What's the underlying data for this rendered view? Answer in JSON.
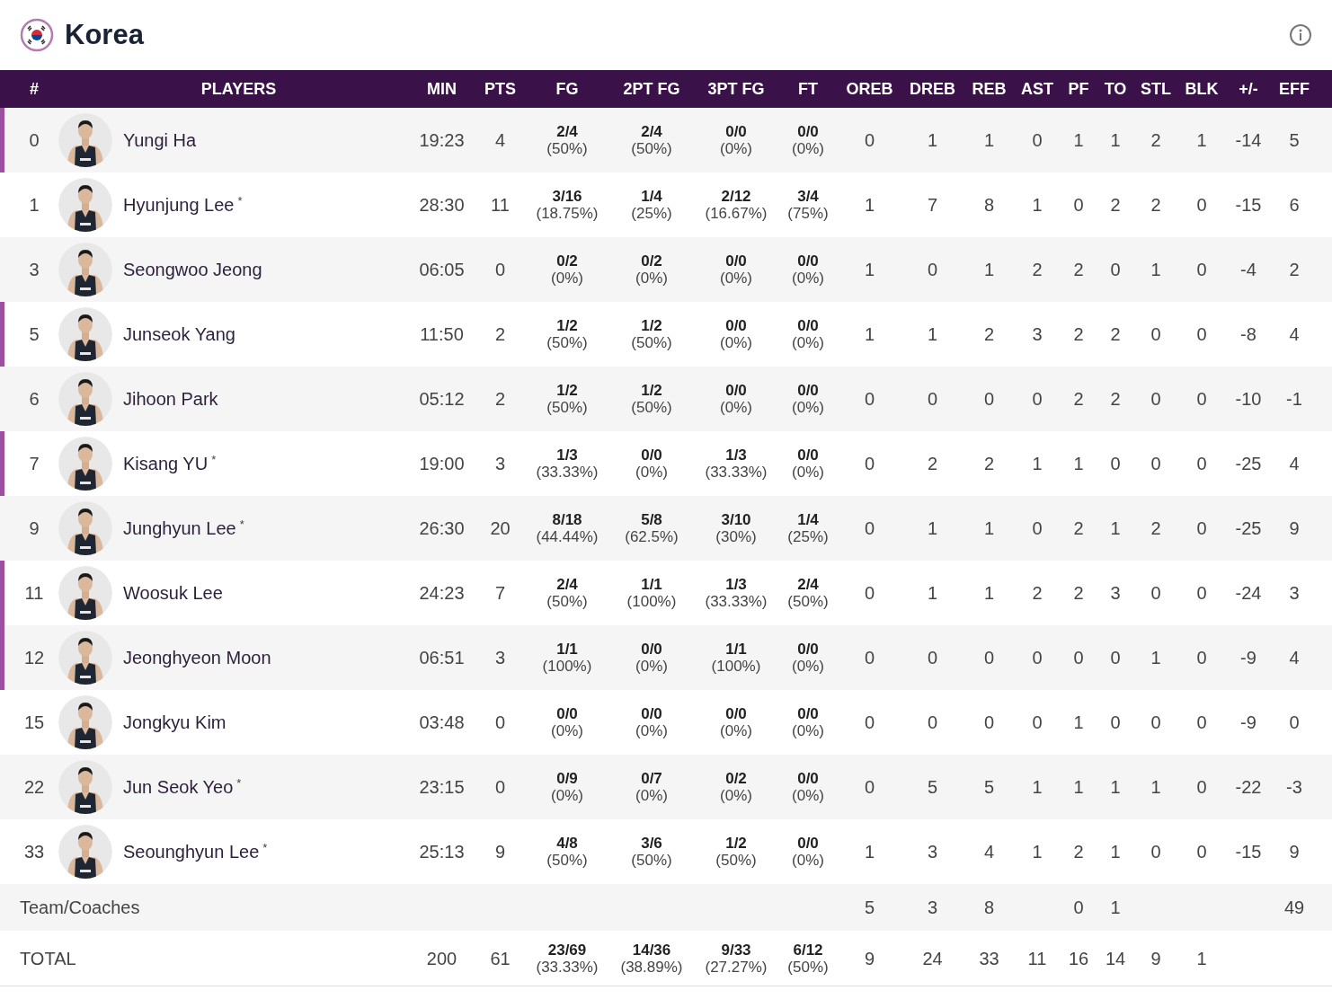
{
  "team": {
    "name": "Korea"
  },
  "columns": [
    "#",
    "PLAYERS",
    "MIN",
    "PTS",
    "FG",
    "2PT FG",
    "3PT FG",
    "FT",
    "OREB",
    "DREB",
    "REB",
    "AST",
    "PF",
    "TO",
    "STL",
    "BLK",
    "+/-",
    "EFF"
  ],
  "players": [
    {
      "number": "0",
      "name": "Yungi Ha",
      "starter": true,
      "min": "19:23",
      "pts": "4",
      "shots": [
        [
          "2/4",
          "(50%)"
        ],
        [
          "2/4",
          "(50%)"
        ],
        [
          "0/0",
          "(0%)"
        ],
        [
          "0/0",
          "(0%)"
        ]
      ],
      "stats": [
        "0",
        "1",
        "1",
        "0",
        "1",
        "1",
        "2",
        "1",
        "-14",
        "5"
      ]
    },
    {
      "number": "1",
      "name": "Hyunjung Lee",
      "mark": "*",
      "starter": false,
      "min": "28:30",
      "pts": "11",
      "shots": [
        [
          "3/16",
          "(18.75%)"
        ],
        [
          "1/4",
          "(25%)"
        ],
        [
          "2/12",
          "(16.67%)"
        ],
        [
          "3/4",
          "(75%)"
        ]
      ],
      "stats": [
        "1",
        "7",
        "8",
        "1",
        "0",
        "2",
        "2",
        "0",
        "-15",
        "6"
      ]
    },
    {
      "number": "3",
      "name": "Seongwoo Jeong",
      "starter": false,
      "min": "06:05",
      "pts": "0",
      "shots": [
        [
          "0/2",
          "(0%)"
        ],
        [
          "0/2",
          "(0%)"
        ],
        [
          "0/0",
          "(0%)"
        ],
        [
          "0/0",
          "(0%)"
        ]
      ],
      "stats": [
        "1",
        "0",
        "1",
        "2",
        "2",
        "0",
        "1",
        "0",
        "-4",
        "2"
      ]
    },
    {
      "number": "5",
      "name": "Junseok Yang",
      "starter": true,
      "min": "11:50",
      "pts": "2",
      "shots": [
        [
          "1/2",
          "(50%)"
        ],
        [
          "1/2",
          "(50%)"
        ],
        [
          "0/0",
          "(0%)"
        ],
        [
          "0/0",
          "(0%)"
        ]
      ],
      "stats": [
        "1",
        "1",
        "2",
        "3",
        "2",
        "2",
        "0",
        "0",
        "-8",
        "4"
      ]
    },
    {
      "number": "6",
      "name": "Jihoon Park",
      "starter": false,
      "min": "05:12",
      "pts": "2",
      "shots": [
        [
          "1/2",
          "(50%)"
        ],
        [
          "1/2",
          "(50%)"
        ],
        [
          "0/0",
          "(0%)"
        ],
        [
          "0/0",
          "(0%)"
        ]
      ],
      "stats": [
        "0",
        "0",
        "0",
        "0",
        "2",
        "2",
        "0",
        "0",
        "-10",
        "-1"
      ]
    },
    {
      "number": "7",
      "name": "Kisang YU",
      "mark": "*",
      "starter": true,
      "min": "19:00",
      "pts": "3",
      "shots": [
        [
          "1/3",
          "(33.33%)"
        ],
        [
          "0/0",
          "(0%)"
        ],
        [
          "1/3",
          "(33.33%)"
        ],
        [
          "0/0",
          "(0%)"
        ]
      ],
      "stats": [
        "0",
        "2",
        "2",
        "1",
        "1",
        "0",
        "0",
        "0",
        "-25",
        "4"
      ]
    },
    {
      "number": "9",
      "name": "Junghyun Lee",
      "mark": "*",
      "starter": false,
      "min": "26:30",
      "pts": "20",
      "shots": [
        [
          "8/18",
          "(44.44%)"
        ],
        [
          "5/8",
          "(62.5%)"
        ],
        [
          "3/10",
          "(30%)"
        ],
        [
          "1/4",
          "(25%)"
        ]
      ],
      "stats": [
        "0",
        "1",
        "1",
        "0",
        "2",
        "1",
        "2",
        "0",
        "-25",
        "9"
      ]
    },
    {
      "number": "11",
      "name": "Woosuk Lee",
      "starter": true,
      "min": "24:23",
      "pts": "7",
      "shots": [
        [
          "2/4",
          "(50%)"
        ],
        [
          "1/1",
          "(100%)"
        ],
        [
          "1/3",
          "(33.33%)"
        ],
        [
          "2/4",
          "(50%)"
        ]
      ],
      "stats": [
        "0",
        "1",
        "1",
        "2",
        "2",
        "3",
        "0",
        "0",
        "-24",
        "3"
      ]
    },
    {
      "number": "12",
      "name": "Jeonghyeon Moon",
      "starter": true,
      "min": "06:51",
      "pts": "3",
      "shots": [
        [
          "1/1",
          "(100%)"
        ],
        [
          "0/0",
          "(0%)"
        ],
        [
          "1/1",
          "(100%)"
        ],
        [
          "0/0",
          "(0%)"
        ]
      ],
      "stats": [
        "0",
        "0",
        "0",
        "0",
        "0",
        "0",
        "1",
        "0",
        "-9",
        "4"
      ]
    },
    {
      "number": "15",
      "name": "Jongkyu Kim",
      "starter": false,
      "min": "03:48",
      "pts": "0",
      "shots": [
        [
          "0/0",
          "(0%)"
        ],
        [
          "0/0",
          "(0%)"
        ],
        [
          "0/0",
          "(0%)"
        ],
        [
          "0/0",
          "(0%)"
        ]
      ],
      "stats": [
        "0",
        "0",
        "0",
        "0",
        "1",
        "0",
        "0",
        "0",
        "-9",
        "0"
      ]
    },
    {
      "number": "22",
      "name": "Jun Seok Yeo",
      "mark": "*",
      "starter": false,
      "min": "23:15",
      "pts": "0",
      "shots": [
        [
          "0/9",
          "(0%)"
        ],
        [
          "0/7",
          "(0%)"
        ],
        [
          "0/2",
          "(0%)"
        ],
        [
          "0/0",
          "(0%)"
        ]
      ],
      "stats": [
        "0",
        "5",
        "5",
        "1",
        "1",
        "1",
        "1",
        "0",
        "-22",
        "-3"
      ]
    },
    {
      "number": "33",
      "name": "Seounghyun Lee",
      "mark": "*",
      "starter": false,
      "min": "25:13",
      "pts": "9",
      "shots": [
        [
          "4/8",
          "(50%)"
        ],
        [
          "3/6",
          "(50%)"
        ],
        [
          "1/2",
          "(50%)"
        ],
        [
          "0/0",
          "(0%)"
        ]
      ],
      "stats": [
        "1",
        "3",
        "4",
        "1",
        "2",
        "1",
        "0",
        "0",
        "-15",
        "9"
      ]
    }
  ],
  "team_row": {
    "label": "Team/Coaches",
    "stats": {
      "oreb": "5",
      "dreb": "3",
      "reb": "8",
      "pf": "0",
      "to": "1",
      "eff": "49"
    }
  },
  "total_row": {
    "label": "TOTAL",
    "min": "200",
    "pts": "61",
    "shots": [
      [
        "23/69",
        "(33.33%)"
      ],
      [
        "14/36",
        "(38.89%)"
      ],
      [
        "9/33",
        "(27.27%)"
      ],
      [
        "6/12",
        "(50%)"
      ]
    ],
    "stats": {
      "oreb": "9",
      "dreb": "24",
      "reb": "33",
      "ast": "11",
      "pf": "16",
      "to": "14",
      "stl": "9",
      "blk": "1"
    }
  }
}
